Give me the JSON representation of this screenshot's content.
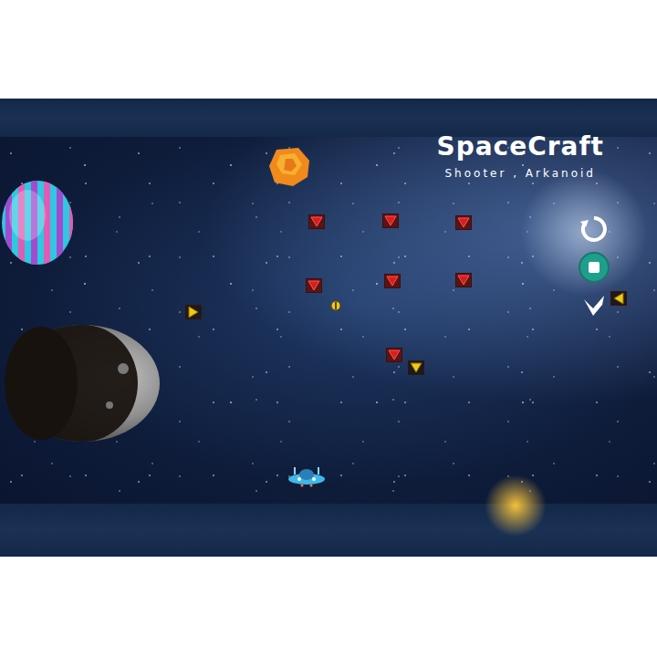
{
  "game": {
    "title": "SpaceCraft",
    "subtitle": "Shooter , Arkanoid"
  },
  "enemies": [
    {
      "kind": "down",
      "color": "#d91c1c"
    },
    {
      "kind": "down",
      "color": "#d91c1c"
    },
    {
      "kind": "down",
      "color": "#d91c1c"
    },
    {
      "kind": "down",
      "color": "#d91c1c"
    },
    {
      "kind": "down",
      "color": "#d91c1c"
    },
    {
      "kind": "down",
      "color": "#d91c1c"
    },
    {
      "kind": "down",
      "color": "#d91c1c"
    },
    {
      "kind": "right",
      "color": "#f2c811"
    },
    {
      "kind": "down",
      "color": "#f2c811"
    },
    {
      "kind": "left",
      "color": "#f2c811"
    }
  ],
  "pickups": [
    {
      "kind": "coin",
      "color": "#f2c811"
    }
  ],
  "controls": [
    {
      "kind": "restart"
    },
    {
      "kind": "stop"
    },
    {
      "kind": "back"
    }
  ]
}
